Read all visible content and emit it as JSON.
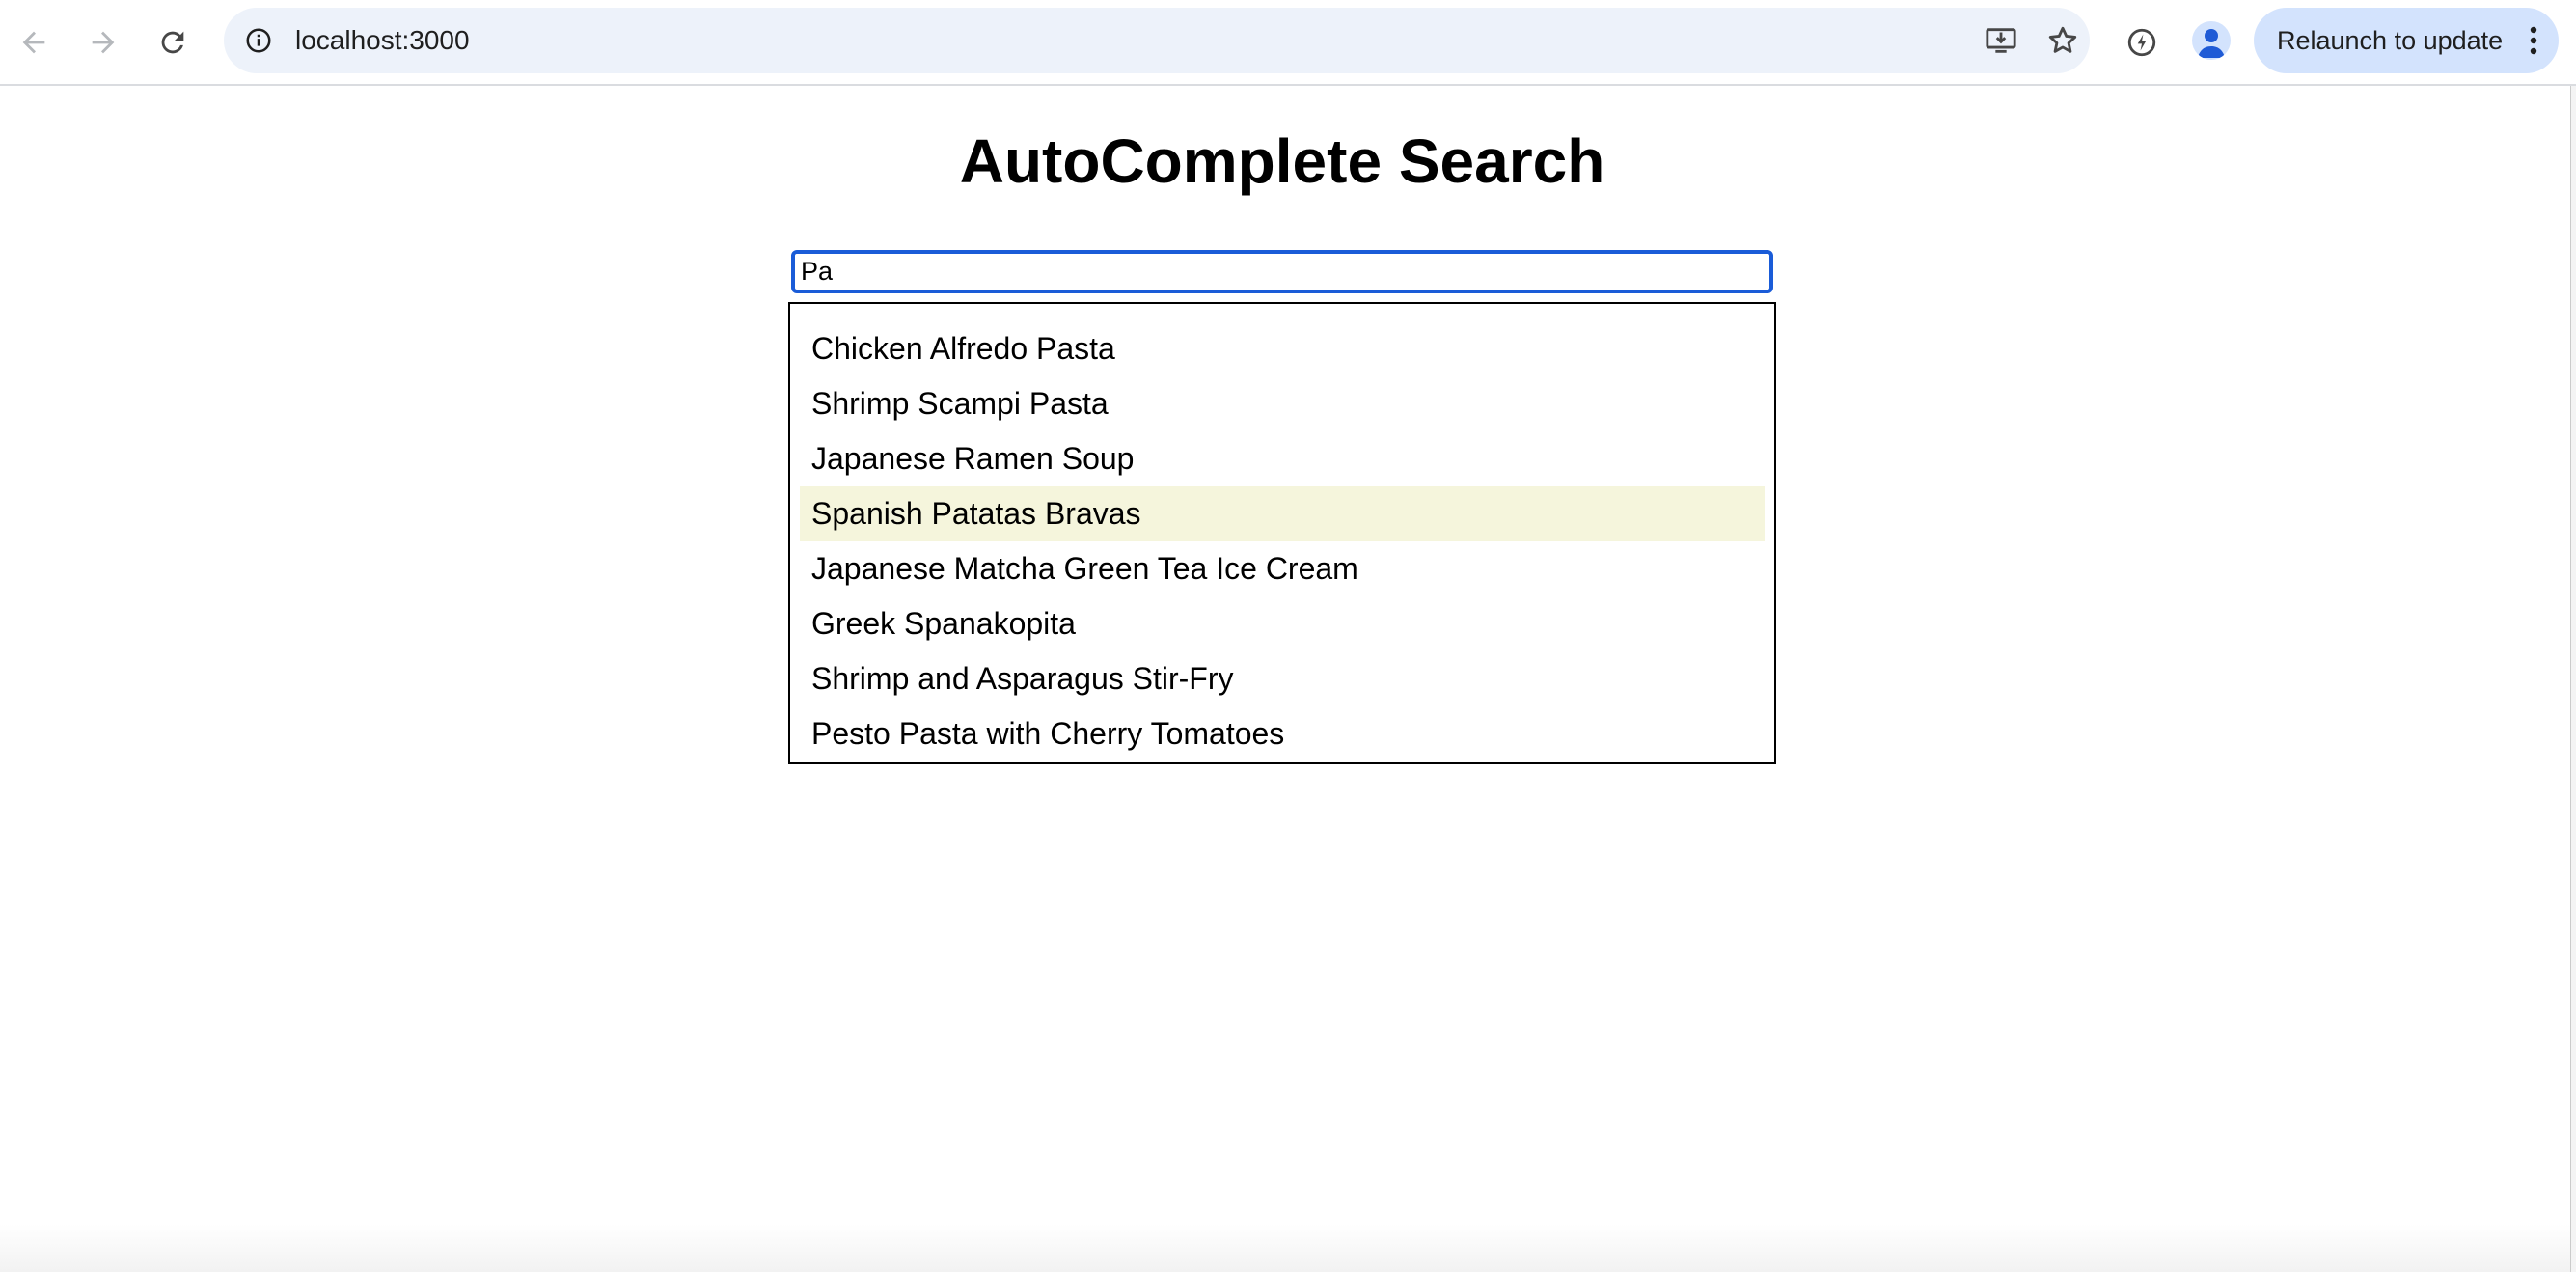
{
  "browser": {
    "url": "localhost:3000",
    "relaunch_label": "Relaunch to update",
    "icons": {
      "back": "back-arrow-icon",
      "forward": "forward-arrow-icon",
      "reload": "reload-icon",
      "site_info": "info-icon",
      "install": "install-app-icon",
      "bookmark": "star-icon",
      "performance": "performance-icon",
      "profile": "profile-icon",
      "menu": "kebab-menu-icon"
    }
  },
  "page": {
    "title": "AutoComplete Search",
    "search": {
      "value": "Pa"
    },
    "suggestions": [
      "Chicken Alfredo Pasta",
      "Shrimp Scampi Pasta",
      "Japanese Ramen Soup",
      "Spanish Patatas Bravas",
      "Japanese Matcha Green Tea Ice Cream",
      "Greek Spanakopita",
      "Shrimp and Asparagus Stir-Fry",
      "Pesto Pasta with Cherry Tomatoes"
    ],
    "highlighted_index": 3
  },
  "colors": {
    "highlight": "#f5f5dc",
    "input_focus": "#1a5cd8",
    "omnibox": "#edf2fa",
    "relaunch": "#d3e3fd"
  }
}
